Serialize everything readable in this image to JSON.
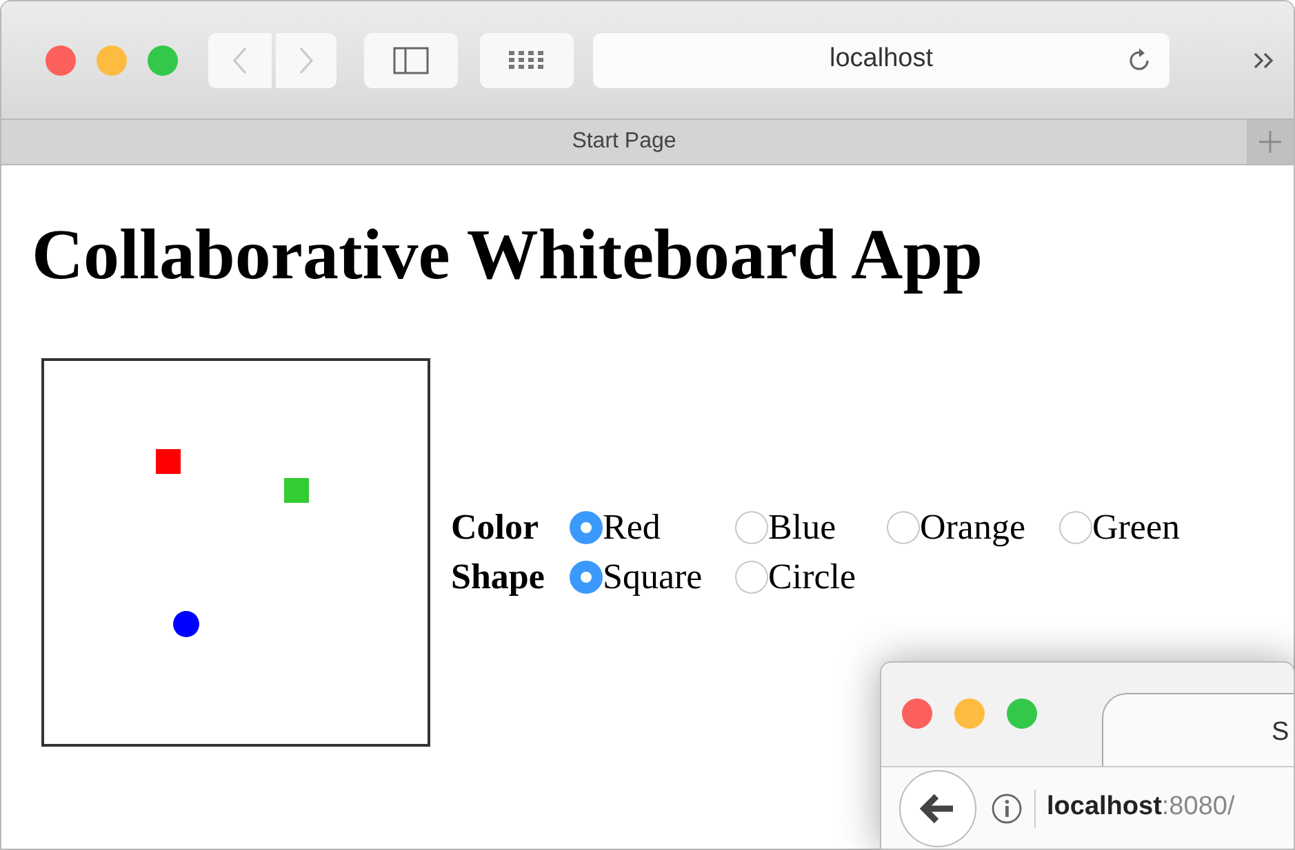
{
  "window": {
    "url": "localhost",
    "tab": "Start Page"
  },
  "page": {
    "heading": "Collaborative Whiteboard App",
    "shapes": [
      {
        "kind": "square",
        "color": "#ff0000"
      },
      {
        "kind": "square",
        "color": "#33cc33"
      },
      {
        "kind": "circle",
        "color": "#0000ff"
      }
    ],
    "groups": [
      {
        "label": "Color",
        "options": [
          {
            "label": "Red",
            "selected": true
          },
          {
            "label": "Blue",
            "selected": false
          },
          {
            "label": "Orange",
            "selected": false
          },
          {
            "label": "Green",
            "selected": false
          }
        ]
      },
      {
        "label": "Shape",
        "options": [
          {
            "label": "Square",
            "selected": true
          },
          {
            "label": "Circle",
            "selected": false
          }
        ]
      }
    ]
  },
  "second_window": {
    "tab": "S",
    "url_host": "localhost",
    "url_rest": ":8080/"
  }
}
